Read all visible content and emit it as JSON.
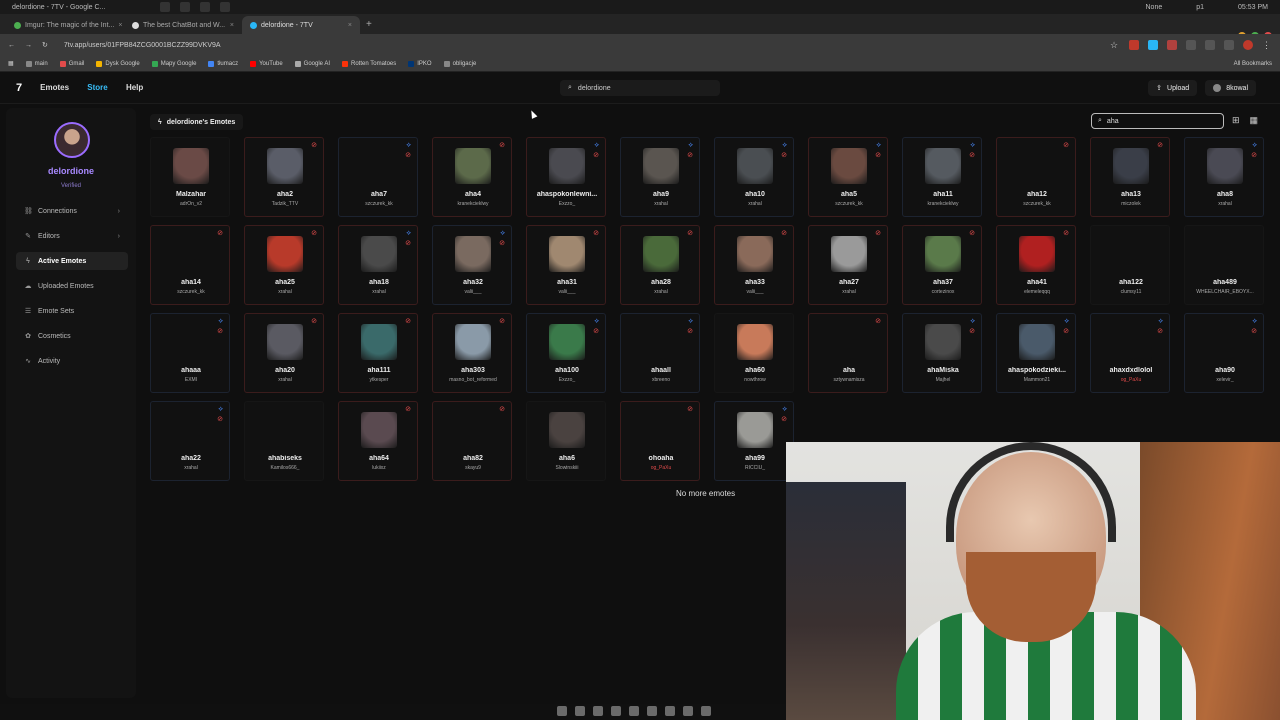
{
  "os": {
    "title": "delordione - 7TV - Google C...",
    "status_left": "None",
    "status_mid": "p1",
    "clock": "05:53 PM"
  },
  "browser": {
    "tabs": [
      {
        "label": "Imgur: The magic of the Int..."
      },
      {
        "label": "The best ChatBot and W..."
      },
      {
        "label": "delordione - 7TV"
      }
    ],
    "url": "7tv.app/users/01FPB84ZCG0001BCZZ99DVKV9A",
    "bookmarks": [
      "main",
      "Gmail",
      "Dysk Google",
      "Mapy Google",
      "tłumacz",
      "YouTube",
      "Google AI",
      "Rotten Tomatoes",
      "IPKO",
      "obligacje"
    ],
    "all_bookmarks": "All Bookmarks"
  },
  "header": {
    "logo": "7",
    "nav": [
      "Emotes",
      "Store",
      "Help"
    ],
    "search_value": "delordione",
    "upload_label": "Upload",
    "account_label": "8kowal"
  },
  "profile": {
    "username": "delordione",
    "badge": "Verified"
  },
  "sidebar": {
    "items": [
      {
        "label": "Connections",
        "icon": "link-icon",
        "chevron": true
      },
      {
        "label": "Editors",
        "icon": "pencil-icon",
        "chevron": true
      },
      {
        "label": "Active Emotes",
        "icon": "bolt-icon",
        "active": true
      },
      {
        "label": "Uploaded Emotes",
        "icon": "cloud-upload-icon"
      },
      {
        "label": "Emote Sets",
        "icon": "list-icon"
      },
      {
        "label": "Cosmetics",
        "icon": "brush-icon"
      },
      {
        "label": "Activity",
        "icon": "activity-icon"
      }
    ]
  },
  "content": {
    "title": "delordione's Emotes",
    "filter_value": "aha",
    "no_more": "No more emotes"
  },
  "emotes": [
    {
      "name": "Malzahar",
      "owner": "adrOn_v2",
      "zero": false,
      "priv": false,
      "border": "none",
      "color": "#6a4a46"
    },
    {
      "name": "aha2",
      "owner": "Tadzik_TTV",
      "zero": false,
      "priv": true,
      "border": "red",
      "color": "#5a5d68"
    },
    {
      "name": "aha7",
      "owner": "szczurek_kk",
      "zero": true,
      "priv": true,
      "border": "blue",
      "color": ""
    },
    {
      "name": "aha4",
      "owner": "kranekcieklwy",
      "zero": false,
      "priv": true,
      "border": "red",
      "color": "#5c6a4a"
    },
    {
      "name": "ahaspokonlewni...",
      "owner": "Exzzo_",
      "zero": true,
      "priv": true,
      "border": "red",
      "color": "#4a4a50"
    },
    {
      "name": "aha9",
      "owner": "xrahal",
      "zero": true,
      "priv": true,
      "border": "blue",
      "color": "#5a5550"
    },
    {
      "name": "aha10",
      "owner": "xrahal",
      "zero": true,
      "priv": true,
      "border": "blue",
      "color": "#4a4e52"
    },
    {
      "name": "aha5",
      "owner": "szczurek_kk",
      "zero": true,
      "priv": true,
      "border": "red",
      "color": "#6a4a40"
    },
    {
      "name": "aha11",
      "owner": "kranekcieklwy",
      "zero": true,
      "priv": true,
      "border": "blue",
      "color": "#555a60"
    },
    {
      "name": "aha12",
      "owner": "szczurek_kk",
      "zero": false,
      "priv": true,
      "border": "red",
      "color": ""
    },
    {
      "name": "aha13",
      "owner": "miczolek",
      "zero": false,
      "priv": true,
      "border": "red",
      "color": "#3a3e48"
    },
    {
      "name": "aha8",
      "owner": "xrahal",
      "zero": true,
      "priv": true,
      "border": "blue",
      "color": "#4a4a54"
    },
    {
      "name": "aha14",
      "owner": "szczurek_kk",
      "zero": false,
      "priv": true,
      "border": "red",
      "color": ""
    },
    {
      "name": "aha25",
      "owner": "xrahal",
      "zero": false,
      "priv": true,
      "border": "red",
      "color": "#b83a2a"
    },
    {
      "name": "aha18",
      "owner": "xrahal",
      "zero": true,
      "priv": true,
      "border": "red",
      "color": "#4a4a4a"
    },
    {
      "name": "aha32",
      "owner": "valii___",
      "zero": true,
      "priv": true,
      "border": "blue",
      "color": "#7a6a60"
    },
    {
      "name": "aha31",
      "owner": "valii___",
      "zero": false,
      "priv": true,
      "border": "red",
      "color": "#a08870"
    },
    {
      "name": "aha28",
      "owner": "xrahal",
      "zero": false,
      "priv": true,
      "border": "red",
      "color": "#4a6a3a"
    },
    {
      "name": "aha33",
      "owner": "valii___",
      "zero": false,
      "priv": true,
      "border": "red",
      "color": "#8a6a5a"
    },
    {
      "name": "aha27",
      "owner": "xrahal",
      "zero": false,
      "priv": true,
      "border": "red",
      "color": "#9a9a9a"
    },
    {
      "name": "aha37",
      "owner": "cortezinox",
      "zero": false,
      "priv": true,
      "border": "red",
      "color": "#5a7a4a"
    },
    {
      "name": "aha41",
      "owner": "elemeleqqq",
      "zero": false,
      "priv": true,
      "border": "red",
      "color": "#b02020"
    },
    {
      "name": "aha122",
      "owner": "clumsy11",
      "zero": false,
      "priv": false,
      "border": "none",
      "color": ""
    },
    {
      "name": "aha489",
      "owner": "WHEELCHAIR_EBOYX...",
      "zero": false,
      "priv": false,
      "border": "none",
      "color": ""
    },
    {
      "name": "ahaaa",
      "owner": "EXMI",
      "zero": true,
      "priv": true,
      "border": "blue",
      "color": ""
    },
    {
      "name": "aha20",
      "owner": "xrahal",
      "zero": false,
      "priv": true,
      "border": "red",
      "color": "#5a5a62"
    },
    {
      "name": "aha111",
      "owner": "ytkesper",
      "zero": false,
      "priv": true,
      "border": "red",
      "color": "#3a6a6a"
    },
    {
      "name": "aha303",
      "owner": "masno_bot_reformed",
      "zero": false,
      "priv": true,
      "border": "red",
      "color": "#8a9aa8"
    },
    {
      "name": "aha100",
      "owner": "Exzzo_",
      "zero": true,
      "priv": true,
      "border": "blue",
      "color": "#3a7a4a"
    },
    {
      "name": "ahaall",
      "owner": "xbreeno",
      "zero": true,
      "priv": true,
      "border": "blue",
      "color": ""
    },
    {
      "name": "aha60",
      "owner": "nowthrow",
      "zero": false,
      "priv": false,
      "border": "none",
      "color": "#c87a5a"
    },
    {
      "name": "aha",
      "owner": "sztywnamisza",
      "zero": false,
      "priv": true,
      "border": "red",
      "color": ""
    },
    {
      "name": "ahaMiska",
      "owner": "Majhel",
      "zero": true,
      "priv": true,
      "border": "blue",
      "color": "#4a4a4a"
    },
    {
      "name": "ahaspokodzieki...",
      "owner": "Mammon21",
      "zero": true,
      "priv": true,
      "border": "blue",
      "color": "#4a5a6a"
    },
    {
      "name": "ahaxdxdlolol",
      "owner": "og_PaXu",
      "zero": true,
      "priv": true,
      "border": "blue",
      "color": "",
      "owner_color": "#e14b4b"
    },
    {
      "name": "aha90",
      "owner": "xelevir_",
      "zero": true,
      "priv": true,
      "border": "blue",
      "color": ""
    },
    {
      "name": "aha22",
      "owner": "xrahal",
      "zero": true,
      "priv": true,
      "border": "blue",
      "color": ""
    },
    {
      "name": "ahabiseks",
      "owner": "Kamilos666_",
      "zero": false,
      "priv": false,
      "border": "none",
      "color": ""
    },
    {
      "name": "aha64",
      "owner": "lukiixz",
      "zero": false,
      "priv": true,
      "border": "red",
      "color": "#5a4a50"
    },
    {
      "name": "aha82",
      "owner": "skayu9",
      "zero": false,
      "priv": true,
      "border": "red",
      "color": ""
    },
    {
      "name": "aha6",
      "owner": "Slowinskiii",
      "zero": false,
      "priv": false,
      "border": "none",
      "color": "#4a4240"
    },
    {
      "name": "ohoaha",
      "owner": "og_PaXu",
      "zero": false,
      "priv": true,
      "border": "red",
      "color": "",
      "owner_color": "#e14b4b"
    },
    {
      "name": "aha99",
      "owner": "RICCIU_",
      "zero": true,
      "priv": true,
      "border": "blue",
      "color": "#9a9a96"
    }
  ],
  "colors": {
    "accent": "#a889ff",
    "store": "#38bdf8",
    "zero_width": "#4a8cff",
    "private": "#e14b4b"
  }
}
